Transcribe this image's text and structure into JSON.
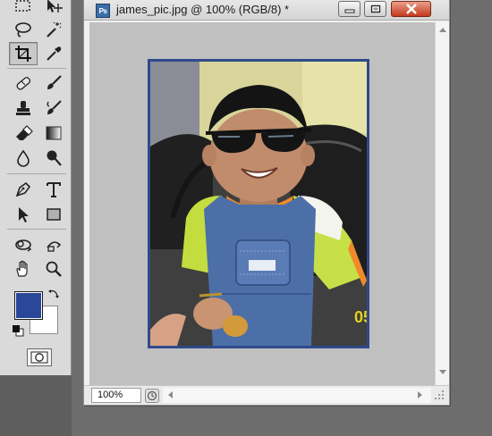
{
  "document": {
    "app_icon_label": "Ps",
    "title": "james_pic.jpg @ 100% (RGB/8) *",
    "zoom_value": "100%",
    "photo_overlay_text": "05"
  },
  "colors": {
    "foreground": "#2b4797",
    "background": "#ffffff",
    "canvas_background": "#c0c0c0",
    "close_button": "#c5391e"
  },
  "tools": [
    {
      "name": "marquee",
      "icon": "rectangular-marquee-icon"
    },
    {
      "name": "move",
      "icon": "move-icon"
    },
    {
      "name": "lasso",
      "icon": "lasso-icon"
    },
    {
      "name": "magic wand",
      "icon": "magic-wand-icon"
    },
    {
      "name": "crop",
      "icon": "crop-icon",
      "active": true
    },
    {
      "name": "eyedropper",
      "icon": "eyedropper-icon"
    },
    {
      "name": "spot healing brush",
      "icon": "healing-brush-icon"
    },
    {
      "name": "brush",
      "icon": "brush-icon"
    },
    {
      "name": "clone stamp",
      "icon": "stamp-icon"
    },
    {
      "name": "history brush",
      "icon": "history-brush-icon"
    },
    {
      "name": "eraser",
      "icon": "eraser-icon"
    },
    {
      "name": "gradient",
      "icon": "gradient-icon"
    },
    {
      "name": "blur",
      "icon": "blur-drop-icon"
    },
    {
      "name": "dodge",
      "icon": "dodge-icon"
    },
    {
      "name": "pen",
      "icon": "pen-icon"
    },
    {
      "name": "type",
      "icon": "type-icon"
    },
    {
      "name": "path selection",
      "icon": "path-selection-arrow-icon"
    },
    {
      "name": "rectangle",
      "icon": "rectangle-shape-icon"
    },
    {
      "name": "3d rotate",
      "icon": "3d-rotate-icon"
    },
    {
      "name": "3d orbit",
      "icon": "3d-orbit-icon"
    },
    {
      "name": "hand",
      "icon": "hand-icon"
    },
    {
      "name": "zoom",
      "icon": "zoom-icon"
    }
  ]
}
